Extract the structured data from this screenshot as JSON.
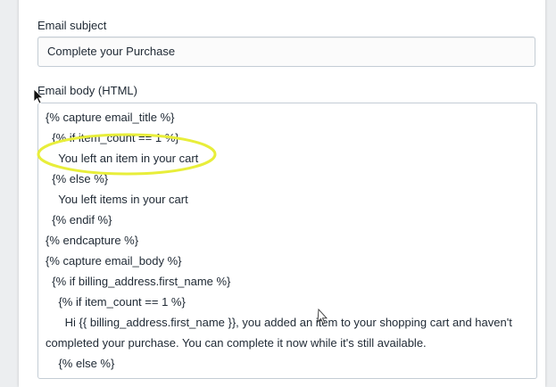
{
  "form": {
    "subject_label": "Email subject",
    "subject_value": "Complete your Purchase",
    "body_label": "Email body (HTML)"
  },
  "body_lines": [
    "{% capture email_title %}",
    "  {% if item_count == 1 %}",
    "    You left an item in your cart",
    "  {% else %}",
    "    You left items in your cart",
    "  {% endif %}",
    "{% endcapture %}",
    "{% capture email_body %}",
    "  {% if billing_address.first_name %}",
    "    {% if item_count == 1 %}",
    "      Hi {{ billing_address.first_name }}, you added an item to your shopping cart and haven't",
    "completed your purchase. You can complete it now while it's still available.",
    "    {% else %}"
  ],
  "annotation": {
    "highlight_color": "#e8ee3a"
  }
}
